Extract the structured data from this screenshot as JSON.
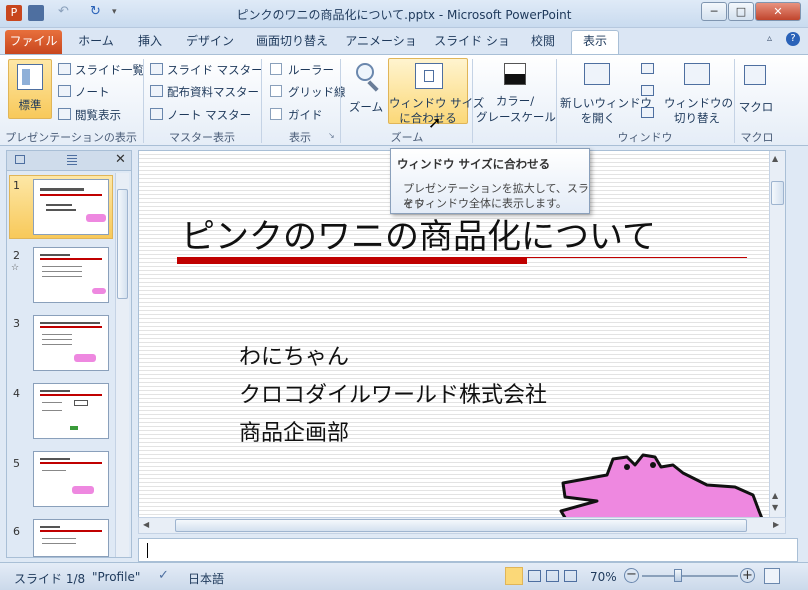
{
  "window": {
    "title": "ピンクのワニの商品化について.pptx  -  Microsoft PowerPoint"
  },
  "tabs": [
    "ホーム",
    "挿入",
    "デザイン",
    "画面切り替え",
    "アニメーション",
    "スライド ショー",
    "校閲",
    "表示"
  ],
  "file_tab": "ファイル",
  "active_tab": "表示",
  "ribbon": {
    "presentation_views": {
      "label": "プレゼンテーションの表示",
      "normal": "標準",
      "slide_list": "スライド一覧",
      "notes": "ノート",
      "reading": "閲覧表示"
    },
    "master_views": {
      "label": "マスター表示",
      "slide_master": "スライド マスター",
      "handout_master": "配布資料マスター",
      "notes_master": "ノート マスター"
    },
    "show": {
      "label": "表示",
      "ruler": "ルーラー",
      "gridlines": "グリッド線",
      "guides": "ガイド"
    },
    "zoom": {
      "label": "ズーム",
      "zoom": "ズーム",
      "fit_line1": "ウィンドウ サイズ",
      "fit_line2": "に合わせる"
    },
    "color": {
      "line1": "カラー/",
      "line2": "グレースケール"
    },
    "window": {
      "label": "ウィンドウ",
      "new_line1": "新しいウィンドウ",
      "new_line2": "を開く",
      "switch_line1": "ウィンドウの",
      "switch_line2": "切り替え"
    },
    "macros": {
      "label": "マクロ",
      "macro": "マクロ"
    }
  },
  "tooltip": {
    "title": "ウィンドウ サイズに合わせる",
    "body_line1": "プレゼンテーションを拡大して、スライド",
    "body_line2": "をウィンドウ全体に表示します。"
  },
  "thumbnails": [
    "1",
    "2",
    "3",
    "4",
    "5",
    "6"
  ],
  "slide": {
    "title": "ピンクのワニの商品化について",
    "line1": "わにちゃん",
    "line2": "クロコダイルワールド株式会社",
    "line3": "商品企画部"
  },
  "status": {
    "slide": "スライド 1/8",
    "theme": "\"Profile\"",
    "language": "日本語",
    "zoom": "70%"
  },
  "colors": {
    "accent_red": "#c00000",
    "crocodile_pink": "#ee88e0",
    "file_tab": "#d8562c"
  }
}
